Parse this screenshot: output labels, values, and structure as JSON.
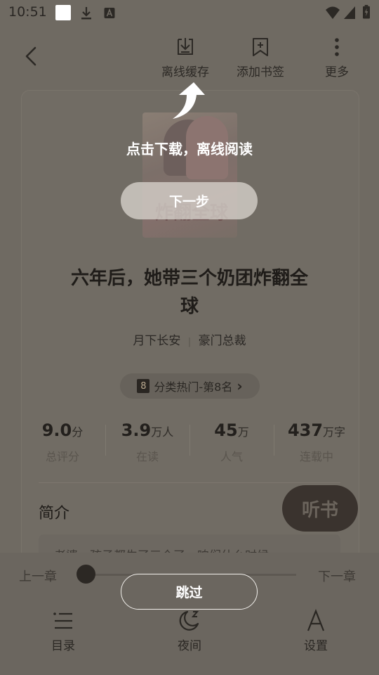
{
  "status_bar": {
    "time": "10:51"
  },
  "header": {
    "offline_cache_label": "离线缓存",
    "add_bookmark_label": "添加书签",
    "more_label": "更多"
  },
  "book": {
    "title_line1": "六年后，她带三个奶团炸翻全",
    "title_line2": "球",
    "author": "月下长安",
    "separator": "|",
    "category": "豪门总裁",
    "rank_number": "8",
    "rank_text": "分类热门-第8名",
    "rank_chevron": "›",
    "cover_text": "炸翻全球"
  },
  "stats": [
    {
      "value": "9.0",
      "unit": "分",
      "label": "总评分"
    },
    {
      "value": "3.9",
      "unit": "万人",
      "label": "在读"
    },
    {
      "value": "45",
      "unit": "万",
      "label": "人气"
    },
    {
      "value": "437",
      "unit": "万字",
      "label": "连载中"
    }
  ],
  "intro": {
    "heading": "简介",
    "listen_label": "听书",
    "preview_text": "老婆，孩子都生了三个了，咱们什么时候"
  },
  "reader_controls": {
    "prev_chapter": "上一章",
    "next_chapter": "下一章",
    "progress_fraction": 0.0,
    "nav": [
      {
        "label": "目录",
        "icon": "menu-list-icon"
      },
      {
        "label": "夜间",
        "icon": "night-moon-icon"
      },
      {
        "label": "设置",
        "icon": "font-settings-icon"
      }
    ]
  },
  "onboarding": {
    "tip": "点击下载，离线阅读",
    "next_step_label": "下一步",
    "skip_label": "跳过"
  }
}
